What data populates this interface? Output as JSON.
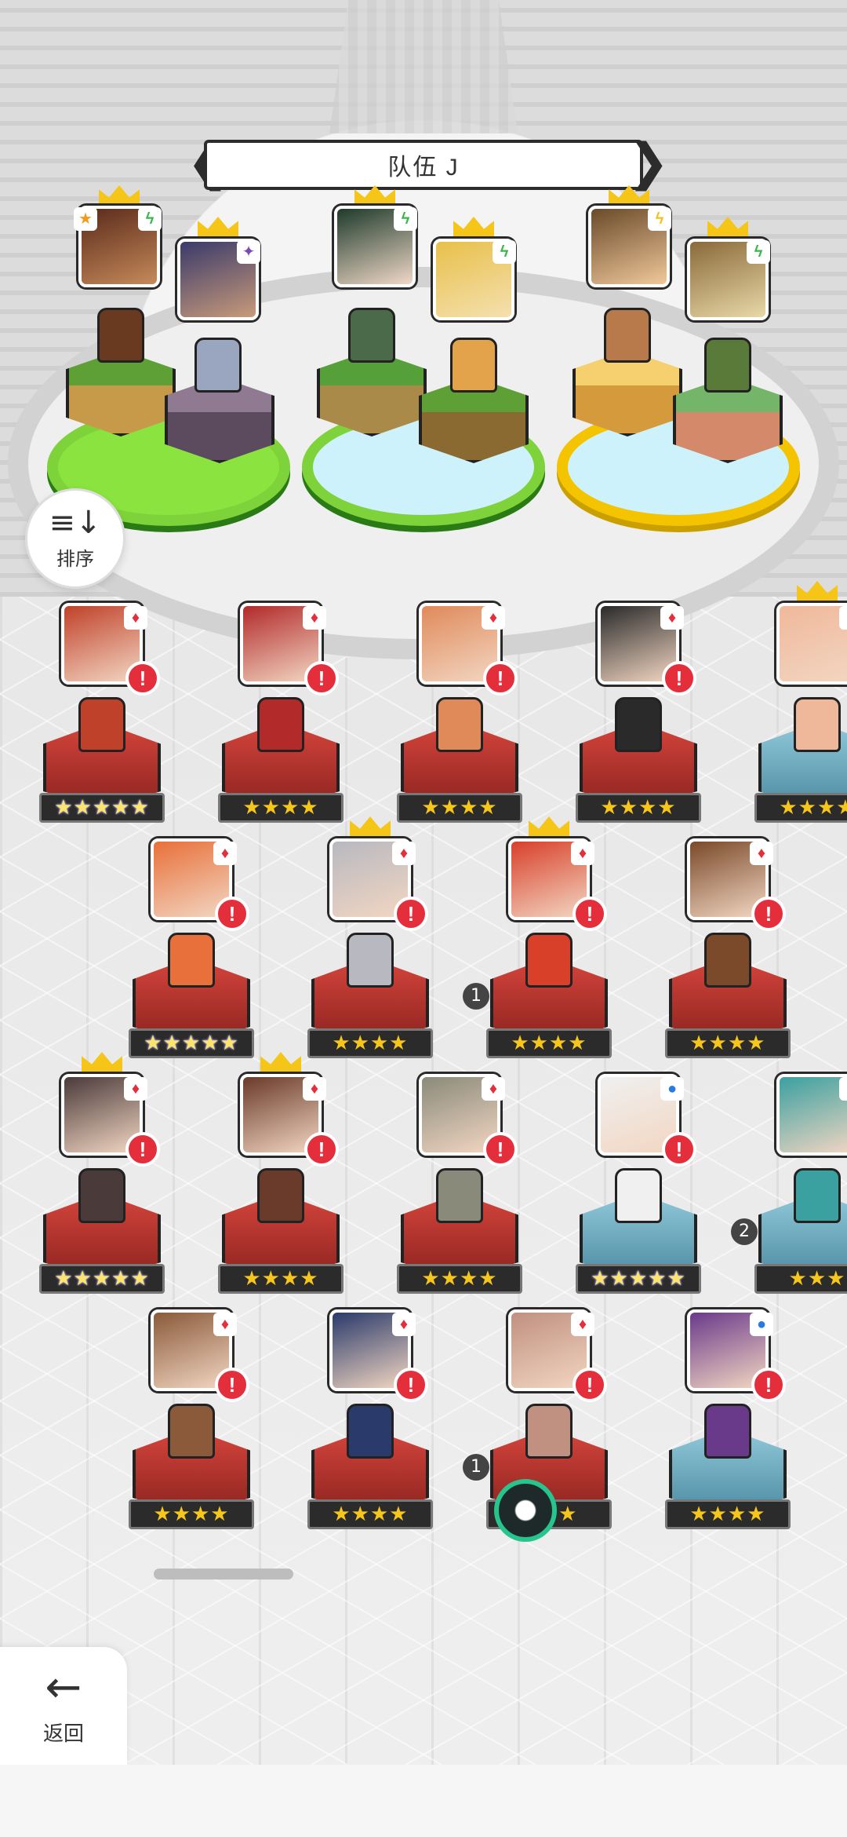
{
  "team": {
    "title": "队伍 J",
    "prev_arrow": "❮",
    "next_arrow": "❯"
  },
  "sort_button": {
    "icon": "≡↓",
    "label": "排序"
  },
  "back_button": {
    "icon": "←",
    "label": "返回"
  },
  "colors": {
    "alert_red": "#e42e3c",
    "crown_gold": "#f5c518",
    "platform_green": "#7ed33a",
    "platform_gold": "#f5c400",
    "star_gold": "#f7c61a"
  },
  "roster": [
    {
      "stars": "★★★★★",
      "rarity": 5,
      "alert": "!"
    },
    {
      "stars": "★★★★",
      "rarity": 4,
      "alert": "!"
    },
    {
      "stars": "★★★★",
      "rarity": 4,
      "alert": "!"
    },
    {
      "stars": "★★★★",
      "rarity": 4,
      "alert": "!"
    },
    {
      "stars": "★★★★",
      "rarity": 4,
      "alert": ""
    },
    {
      "stars": "★★★★★",
      "rarity": 5,
      "alert": "!"
    },
    {
      "stars": "★★★★",
      "rarity": 4,
      "alert": "!"
    },
    {
      "stars": "★★★★",
      "rarity": 4,
      "alert": "!",
      "count": "1"
    },
    {
      "stars": "★★★★",
      "rarity": 4,
      "alert": "!"
    },
    {
      "stars": "★★★★★",
      "rarity": 5,
      "alert": "!"
    },
    {
      "stars": "★★★★",
      "rarity": 4,
      "alert": "!"
    },
    {
      "stars": "★★★★",
      "rarity": 4,
      "alert": "!"
    },
    {
      "stars": "★★★★★",
      "rarity": 5,
      "alert": "!"
    },
    {
      "stars": "★★★",
      "rarity": 3,
      "alert": "",
      "count": "2"
    },
    {
      "stars": "★★★★",
      "rarity": 4,
      "alert": "!"
    },
    {
      "stars": "★★★★",
      "rarity": 4,
      "alert": "!"
    },
    {
      "stars": "★★★",
      "rarity": 3,
      "alert": "!",
      "count": "1"
    },
    {
      "stars": "★★★★",
      "rarity": 4,
      "alert": "!"
    }
  ]
}
